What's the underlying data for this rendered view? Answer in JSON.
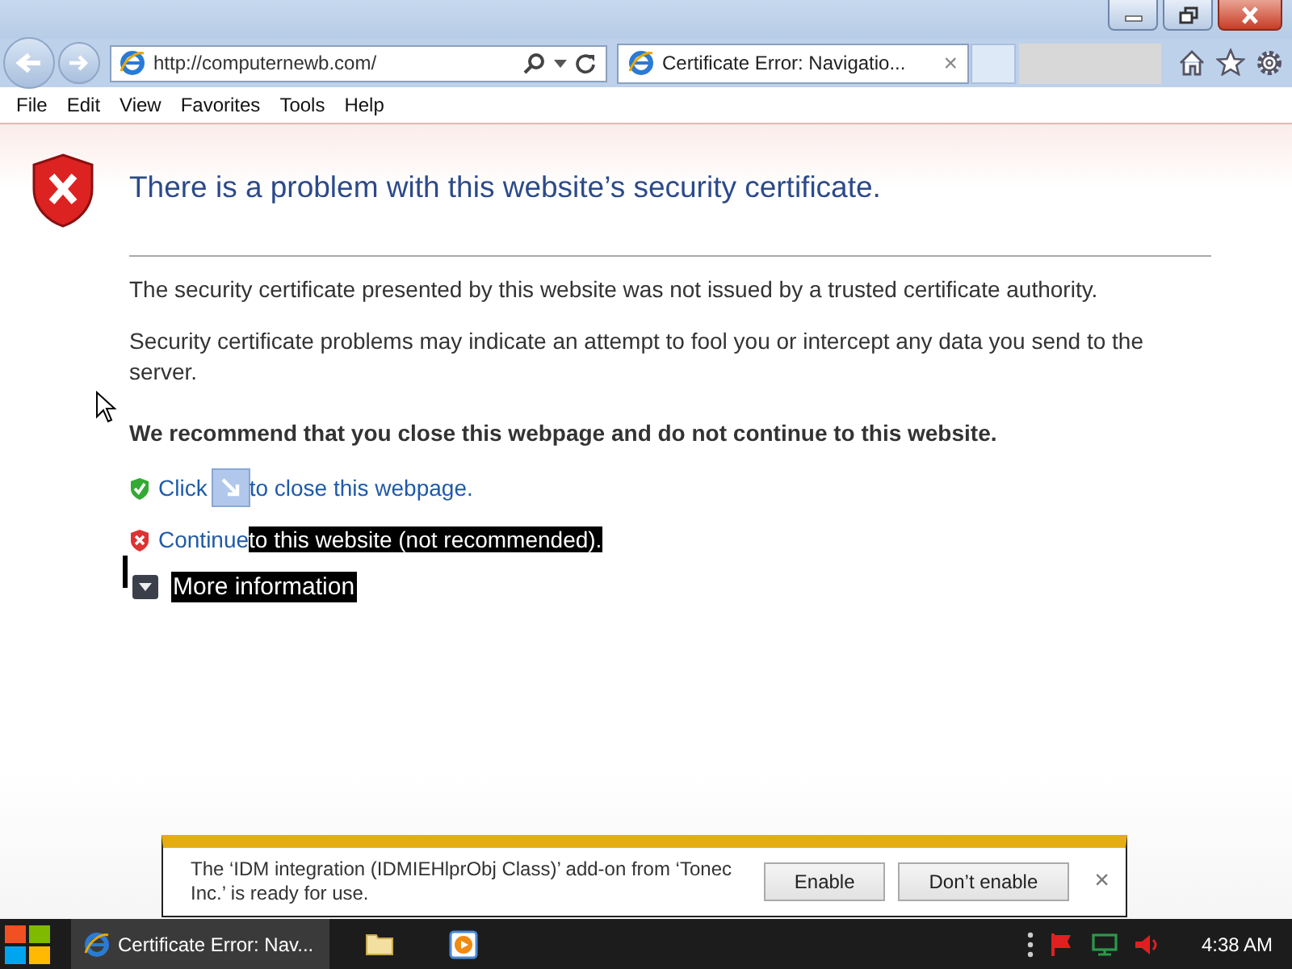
{
  "address_bar": {
    "url": "http://computernewb.com/"
  },
  "tabs": [
    {
      "title": "Certificate Error: Navigatio...",
      "selected": true,
      "close": "×"
    }
  ],
  "menu": [
    "File",
    "Edit",
    "View",
    "Favorites",
    "Tools",
    "Help"
  ],
  "page": {
    "heading": "There is a problem with this website’s security certificate.",
    "paragraphs": [
      "The security certificate presented by this website was not issued by a trusted certificate authority.",
      "Security certificate problems may indicate an attempt to fool you or intercept any data you send to the server."
    ],
    "recommendation": "We recommend that you close this webpage and do not continue to this website.",
    "options": [
      {
        "kind": "safe",
        "link": "Click",
        "rest": "to close this webpage.",
        "highlighted": false
      },
      {
        "kind": "unsafe",
        "link": "Continue",
        "rest": "to this website (not recommended).",
        "highlighted": true
      }
    ],
    "more_info": {
      "label": "More information",
      "highlighted": true,
      "expanded": false
    }
  },
  "notification": {
    "message": "The ‘IDM integration (IDMIEHlprObj Class)’ add-on from ‘Tonec Inc.’ is ready for use.",
    "buttons": [
      "Enable",
      "Don’t enable"
    ],
    "close": "×"
  },
  "taskbar": {
    "window": "Certificate Error: Nav...",
    "clock": "4:38 AM"
  }
}
